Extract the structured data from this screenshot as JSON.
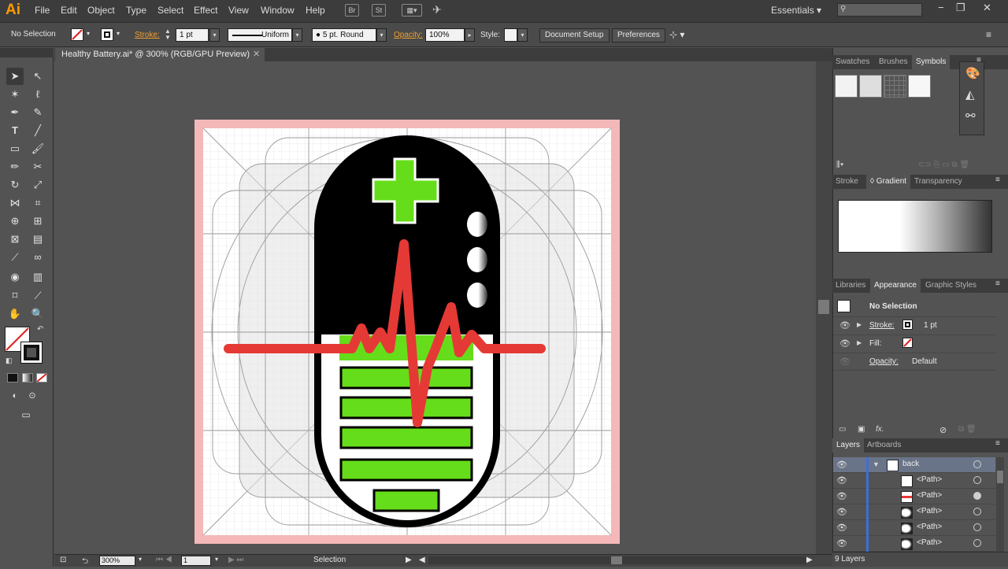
{
  "app": {
    "logo": "Ai",
    "workspace": "Essentials"
  },
  "menu": [
    "File",
    "Edit",
    "Object",
    "Type",
    "Select",
    "Effect",
    "View",
    "Window",
    "Help"
  ],
  "menu_icons": [
    "Br",
    "St"
  ],
  "control": {
    "selection": "No Selection",
    "stroke_label": "Stroke:",
    "stroke_value": "1 pt",
    "profile": "Uniform",
    "brush": "5 pt. Round",
    "opacity_label": "Opacity:",
    "opacity_value": "100%",
    "style_label": "Style:",
    "document_setup": "Document Setup",
    "preferences": "Preferences"
  },
  "document": {
    "tab_title": "Healthy Battery.ai* @ 300% (RGB/GPU Preview)",
    "zoom": "300%",
    "artboard_number": "1",
    "status": "Selection"
  },
  "panels": {
    "top_tabs": [
      "Swatches",
      "Brushes",
      "Symbols"
    ],
    "mid_tabs": [
      "Stroke",
      "Gradient",
      "Transparency"
    ],
    "app_tabs": [
      "Libraries",
      "Appearance",
      "Graphic Styles"
    ],
    "appearance": {
      "title": "No Selection",
      "stroke_label": "Stroke:",
      "stroke_value": "1 pt",
      "fill_label": "Fill:",
      "opacity_label": "Opacity:",
      "opacity_value": "Default"
    },
    "layer_tabs": [
      "Layers",
      "Artboards"
    ],
    "layers": [
      {
        "name": "back"
      },
      {
        "name": "<Path>"
      },
      {
        "name": "<Path>"
      },
      {
        "name": "<Path>"
      },
      {
        "name": "<Path>"
      },
      {
        "name": "<Path>"
      }
    ],
    "layer_count": "9 Layers"
  },
  "colors": {
    "accent_orange": "#ff9a00",
    "battery_green": "#66dd1a",
    "pulse_red": "#e53935",
    "layer_blue": "#3d6fd6"
  }
}
